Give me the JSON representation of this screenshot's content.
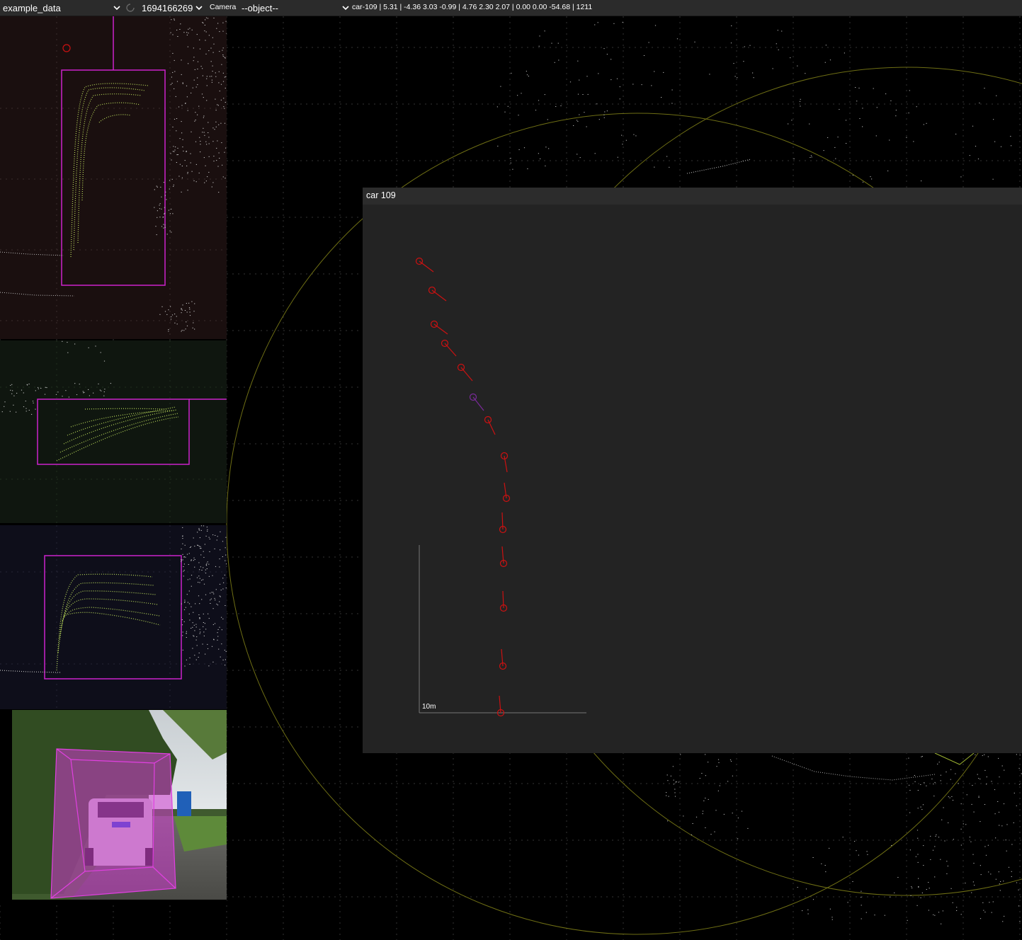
{
  "toolbar": {
    "scene": "example_data",
    "frame": "1694166269",
    "camera_label": "Camera",
    "object_select": "--object--",
    "object_info": "car-109 | 5.31 | -4.36 3.03 -0.99 | 4.76 2.30 2.07 | 0.00 0.00 -54.68 | 1211"
  },
  "track_window": {
    "title": "car 109",
    "scale_label": "10m"
  },
  "colors": {
    "toolbar_bg": "#2b2b2b",
    "box_magenta": "#cc22cc",
    "track_marker": "#cc1111",
    "track_current": "#7a2a9a",
    "lidar_green": "#b8d85a",
    "circle_olive": "#7a7a1a"
  },
  "icons": [
    "chevron-down-icon",
    "refresh-icon"
  ]
}
